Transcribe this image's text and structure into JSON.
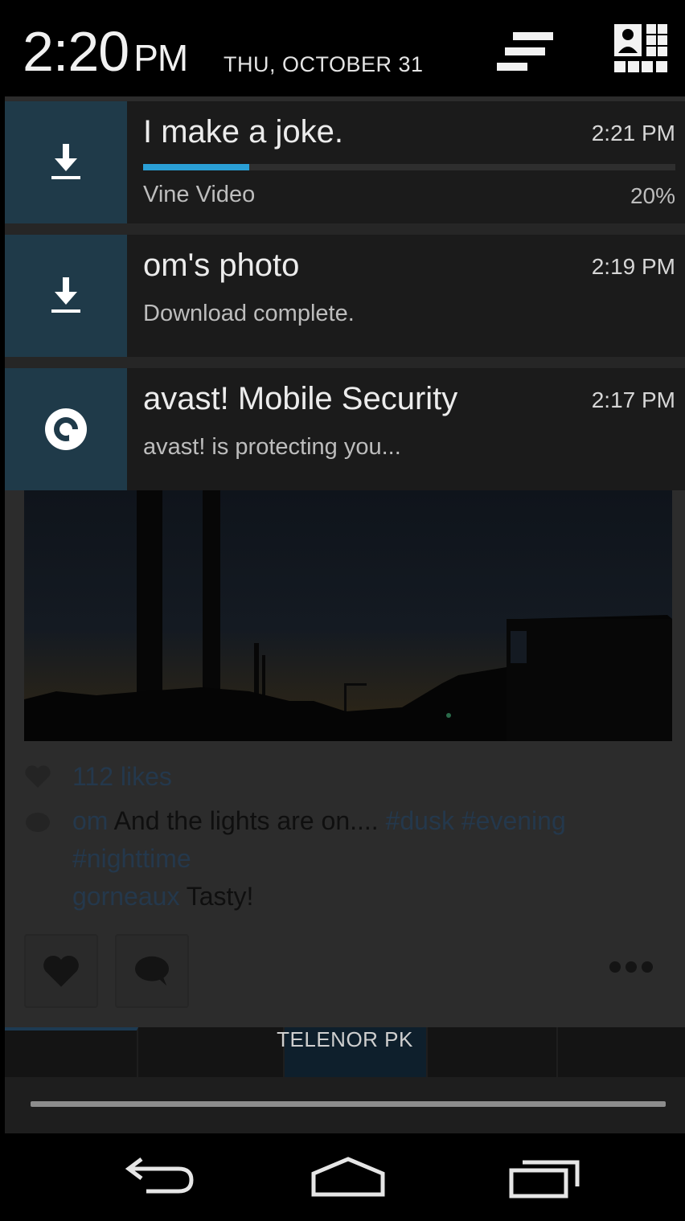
{
  "status_bar": {
    "time": "2:20",
    "ampm": "PM",
    "date": "THU, OCTOBER 31",
    "settings_icon": "sliders-icon",
    "quick_settings_icon": "quick-settings-grid-icon"
  },
  "notifications": [
    {
      "icon": "download-icon",
      "title": "I make a joke.",
      "time": "2:21 PM",
      "subtitle": "Vine Video",
      "progress_label": "20%",
      "progress": 0.2
    },
    {
      "icon": "download-icon",
      "title": "om's photo",
      "time": "2:19 PM",
      "subtitle": "Download complete."
    },
    {
      "icon": "avast-icon",
      "title": "avast! Mobile Security",
      "time": "2:17 PM",
      "subtitle": "avast! is protecting you..."
    }
  ],
  "background_app": {
    "likes": "112 likes",
    "caption": {
      "user": "om",
      "text": " And the lights are on.... ",
      "tag1": "#dusk",
      "tag2": " #evening",
      "tag3": "#nighttime"
    },
    "comment": {
      "user": "gorneaux",
      "text": " Tasty!"
    }
  },
  "carrier": "TELENOR PK",
  "nav": {
    "back_icon": "back-icon",
    "home_icon": "home-icon",
    "recents_icon": "recents-icon"
  },
  "colors": {
    "accent": "#2a9fd6",
    "icon_bg": "#1f3a49",
    "notif_bg": "#1b1b1b"
  }
}
